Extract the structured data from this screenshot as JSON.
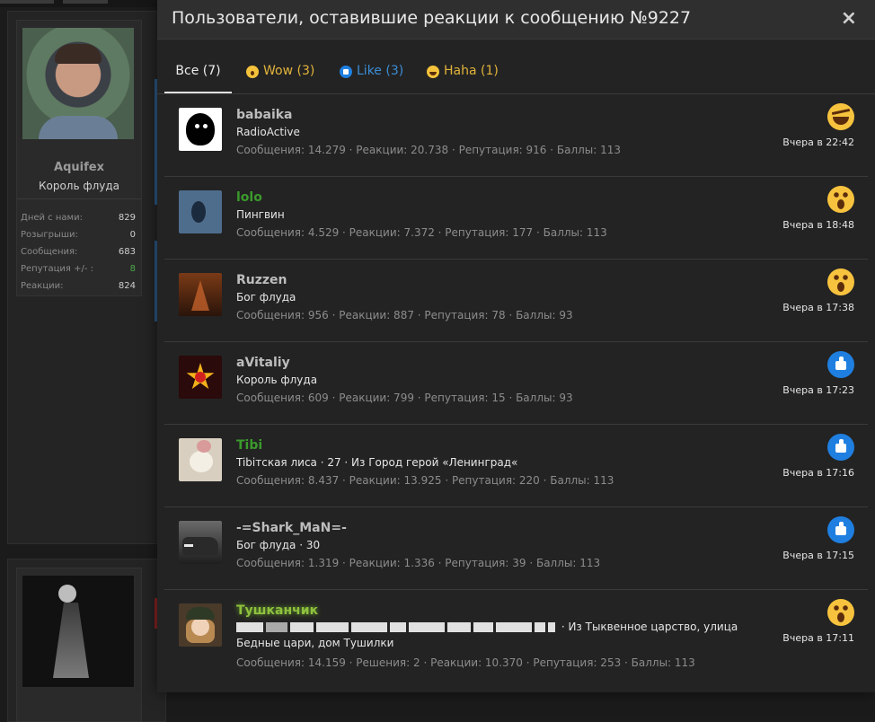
{
  "background": {
    "poster": {
      "name": "Aquifex",
      "title": "Король флуда",
      "stats": [
        {
          "label": "Дней с нами:",
          "value": "829"
        },
        {
          "label": "Розыгрыши:",
          "value": "0"
        },
        {
          "label": "Сообщения:",
          "value": "683"
        },
        {
          "label": "Репутация +/- :",
          "value": "8"
        },
        {
          "label": "Реакции:",
          "value": "824"
        }
      ]
    }
  },
  "modal": {
    "title": "Пользователи, оставившие реакции к сообщению №9227",
    "close_label": "×",
    "tabs": [
      {
        "label": "Все (7)",
        "icon": null,
        "active": true
      },
      {
        "label": "Wow (3)",
        "icon": "wow-icon",
        "active": false
      },
      {
        "label": "Like (3)",
        "icon": "like-icon",
        "active": false
      },
      {
        "label": "Haha (1)",
        "icon": "haha-icon",
        "active": false
      }
    ],
    "users": [
      {
        "name": "babaika",
        "title": "RadioActive",
        "stats": "Сообщения: 14.279 · Реакции: 20.738 · Репутация: 916 · Баллы: 113",
        "time": "Вчера в 22:42",
        "reaction": "haha-icon"
      },
      {
        "name": "lolo",
        "title": "Пингвин",
        "stats": "Сообщения: 4.529 · Реакции: 7.372 · Репутация: 177 · Баллы: 113",
        "time": "Вчера в 18:48",
        "reaction": "wow-icon"
      },
      {
        "name": "Ruzzen",
        "title": "Бог флуда",
        "stats": "Сообщения: 956 · Реакции: 887 · Репутация: 78 · Баллы: 93",
        "time": "Вчера в 17:38",
        "reaction": "wow-icon"
      },
      {
        "name": "aVitaliy",
        "title": "Король флуда",
        "stats": "Сообщения: 609 · Реакции: 799 · Репутация: 15 · Баллы: 93",
        "time": "Вчера в 17:23",
        "reaction": "like-icon"
      },
      {
        "name": "Tibi",
        "title": "Tibiтская лиса · 27 · Из Город герой «Ленинград«",
        "stats": "Сообщения: 8.437 · Реакции: 13.925 · Репутация: 220 · Баллы: 113",
        "time": "Вчера в 17:16",
        "reaction": "like-icon"
      },
      {
        "name": "-=Shark_MaN=-",
        "title": "Бог флуда · 30",
        "stats": "Сообщения: 1.319 · Реакции: 1.336 · Репутация: 39 · Баллы: 113",
        "time": "Вчера в 17:15",
        "reaction": "like-icon"
      },
      {
        "name": "Тушканчик",
        "title": "· Из Тыквенное царство, улица Бедные цари, дом Тушилки",
        "stats": "Сообщения: 14.159 · Решения: 2 · Реакции: 10.370 · Репутация: 253 · Баллы: 113",
        "time": "Вчера в 17:11",
        "reaction": "wow-icon"
      }
    ]
  },
  "colors": {
    "modal_bg": "#232323",
    "header_bg": "#2f2f2f",
    "wow": "#e2b33a",
    "like": "#3b8ed6",
    "green_name": "#3b9a2c",
    "lime_name": "#8fc13e"
  }
}
